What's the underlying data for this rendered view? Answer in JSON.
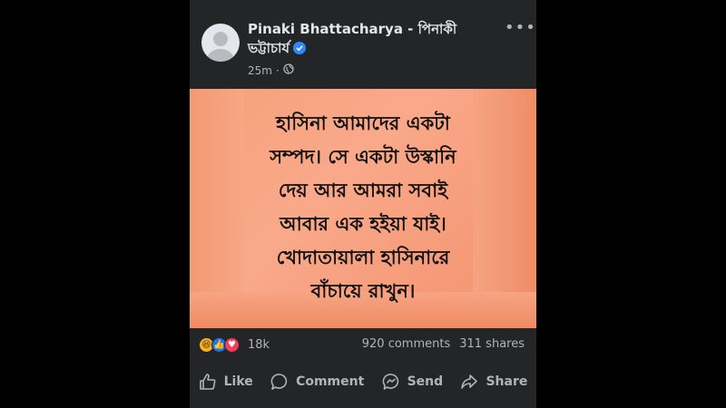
{
  "post": {
    "author": "Pinaki Bhattacharya - পিনাকী ভট্টাচার্য",
    "time": "25m",
    "more": "•••",
    "image_text": "হাসিনা আমাদের একটা\nসম্পদ। সে একটা উস্কানি\nদেয় আর আমরা সবাই\nআবার এক হইয়া যাই।\nখোদাতায়ালা হাসিনারে\nবাঁচায়ে রাখুন।",
    "reactions": {
      "count": "18k",
      "icons": [
        "haha-icon",
        "like-icon",
        "love-icon"
      ],
      "glyphs": {
        "haha": "😆",
        "like": "👍",
        "love": "♥"
      }
    },
    "comments": "920 comments",
    "shares": "311 shares",
    "actions": {
      "like": "Like",
      "comment": "Comment",
      "send": "Send",
      "share": "Share"
    }
  },
  "colors": {
    "background": "#000000",
    "card": "#242526",
    "text": "#e4e6eb",
    "secondary": "#b0b3b8",
    "verified": "#2d88ff",
    "image_bg": "#f5a07a"
  }
}
